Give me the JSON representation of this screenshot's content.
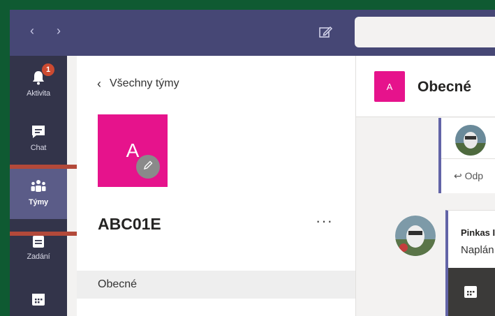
{
  "titlebar": {
    "back_arrow": "‹",
    "forward_arrow": "›",
    "compose_icon": "compose-icon"
  },
  "appbar": {
    "items": [
      {
        "label": "Aktivita",
        "icon": "bell-icon",
        "badge": "1"
      },
      {
        "label": "Chat",
        "icon": "chat-icon"
      },
      {
        "label": "Týmy",
        "icon": "teams-icon",
        "active": true
      },
      {
        "label": "Zadání",
        "icon": "assignments-icon"
      },
      {
        "label": "",
        "icon": "calendar-icon"
      }
    ]
  },
  "teams_panel": {
    "back_label": "Všechny týmy",
    "team_initial": "A",
    "team_name": "ABC01E",
    "more_label": "···",
    "channels": [
      {
        "label": "Obecné"
      }
    ]
  },
  "chat": {
    "channel_initial": "A",
    "title": "Obecné",
    "reply_label": "Odp",
    "author": "Pinkas I",
    "message_preview": "Naplán"
  },
  "colors": {
    "titlebar": "#464775",
    "appbar": "#33344a",
    "team_avatar": "#e6138c",
    "badge": "#cc4a31",
    "highlight": "#b3493a",
    "accent": "#6264a7"
  }
}
